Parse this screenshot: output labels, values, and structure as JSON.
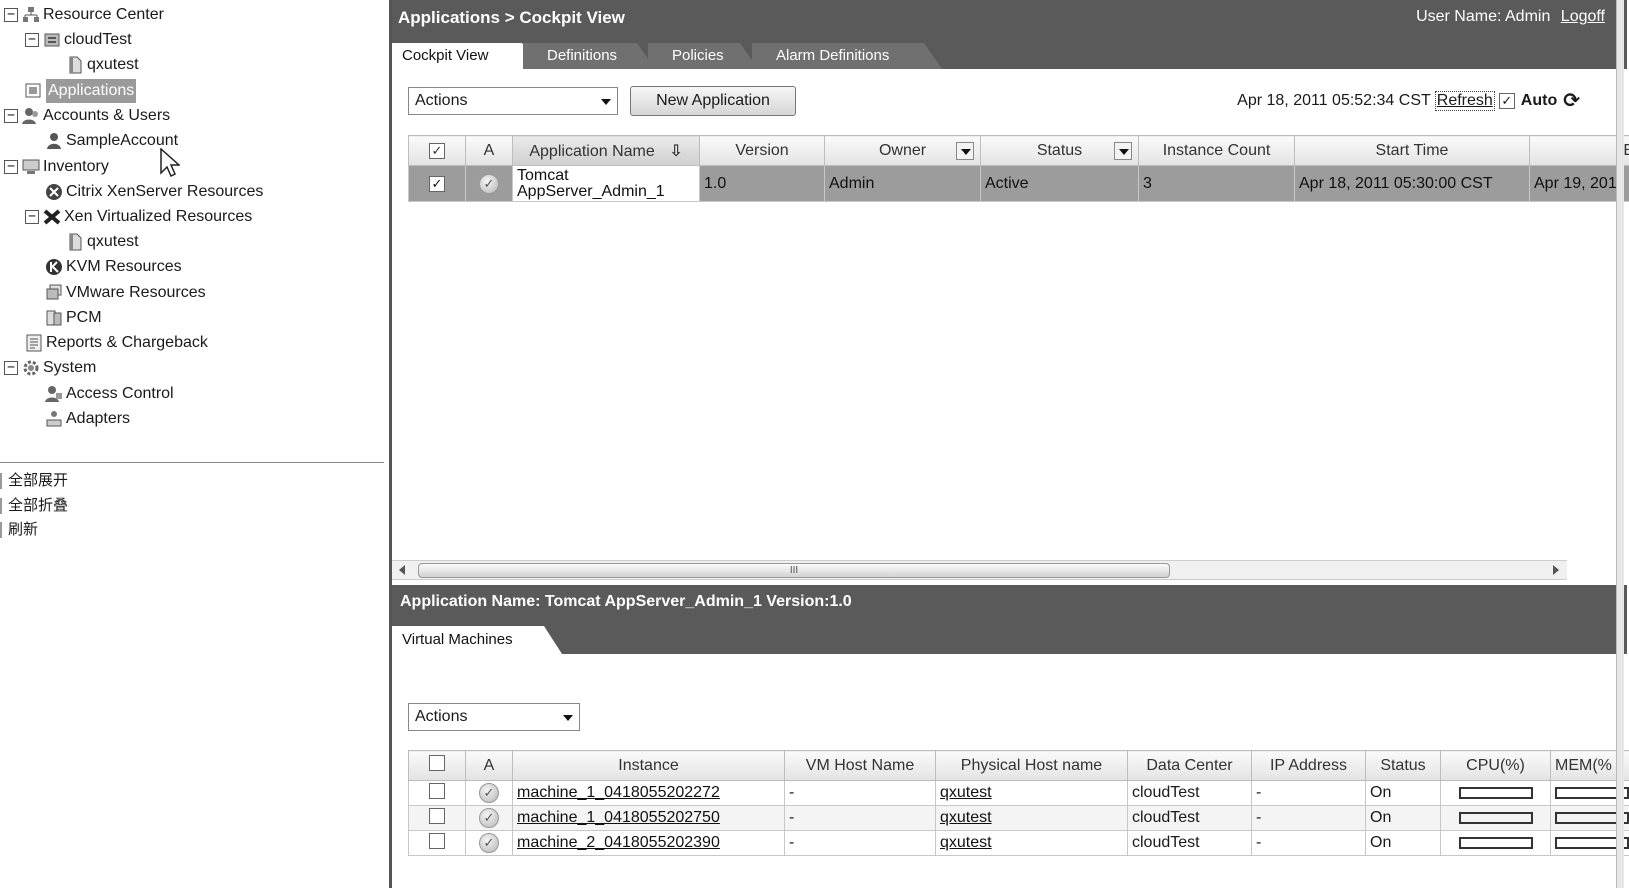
{
  "tree": {
    "resource_center": "Resource Center",
    "cloudtest": "cloudTest",
    "qxutest_1": "qxutest",
    "applications": "Applications",
    "accounts_users": "Accounts & Users",
    "sample_account": "SampleAccount",
    "inventory": "Inventory",
    "citrix": "Citrix XenServer Resources",
    "xen": "Xen Virtualized Resources",
    "qxutest_2": "qxutest",
    "kvm": "KVM Resources",
    "vmware": "VMware Resources",
    "pcm": "PCM",
    "reports": "Reports & Chargeback",
    "system": "System",
    "access_control": "Access Control",
    "adapters": "Adapters",
    "collapse_glyph": "−"
  },
  "context_menu": {
    "expand_all": "全部展开",
    "collapse_all": "全部折叠",
    "refresh": "刷新"
  },
  "header": {
    "breadcrumb": "Applications > Cockpit View",
    "user_label": "User Name: Admin",
    "logoff": "Logoff"
  },
  "tabs": {
    "cockpit": "Cockpit View",
    "definitions": "Definitions",
    "policies": "Policies",
    "alarm_definitions": "Alarm Definitions"
  },
  "toolbar": {
    "actions": "Actions",
    "new_application": "New Application",
    "timestamp": "Apr 18, 2011 05:52:34 CST",
    "refresh": "Refresh",
    "auto": "Auto",
    "check_glyph": "✓",
    "sync_glyph": "⟳"
  },
  "apps_table": {
    "headers": {
      "a": "A",
      "name": "Application Name",
      "version": "Version",
      "owner": "Owner",
      "status": "Status",
      "instance_count": "Instance Count",
      "start_time": "Start Time",
      "end": "E"
    },
    "sort_glyph": "⇩",
    "rows": [
      {
        "name": "Tomcat AppServer_Admin_1",
        "version": "1.0",
        "owner": "Admin",
        "status": "Active",
        "instance_count": "3",
        "start_time": "Apr 18, 2011 05:30:00 CST",
        "end": "Apr 19, 201"
      }
    ]
  },
  "scroll": {
    "grip": "III"
  },
  "detail": {
    "header": "Application Name: Tomcat AppServer_Admin_1   Version:1.0",
    "tab": "Virtual Machines",
    "actions": "Actions"
  },
  "vm_table": {
    "headers": {
      "a": "A",
      "instance": "Instance",
      "vm_host": "VM Host Name",
      "phys_host": "Physical Host name",
      "dc": "Data Center",
      "ip": "IP Address",
      "status": "Status",
      "cpu": "CPU(%)",
      "mem": "MEM(%"
    },
    "rows": [
      {
        "instance": "machine_1_0418055202272",
        "vm_host": "-",
        "phys_host": "qxutest",
        "dc": "cloudTest",
        "ip": "-",
        "status": "On"
      },
      {
        "instance": "machine_1_0418055202750",
        "vm_host": "-",
        "phys_host": "qxutest",
        "dc": "cloudTest",
        "ip": "-",
        "status": "On"
      },
      {
        "instance": "machine_2_0418055202390",
        "vm_host": "-",
        "phys_host": "qxutest",
        "dc": "cloudTest",
        "ip": "-",
        "status": "On"
      }
    ]
  }
}
